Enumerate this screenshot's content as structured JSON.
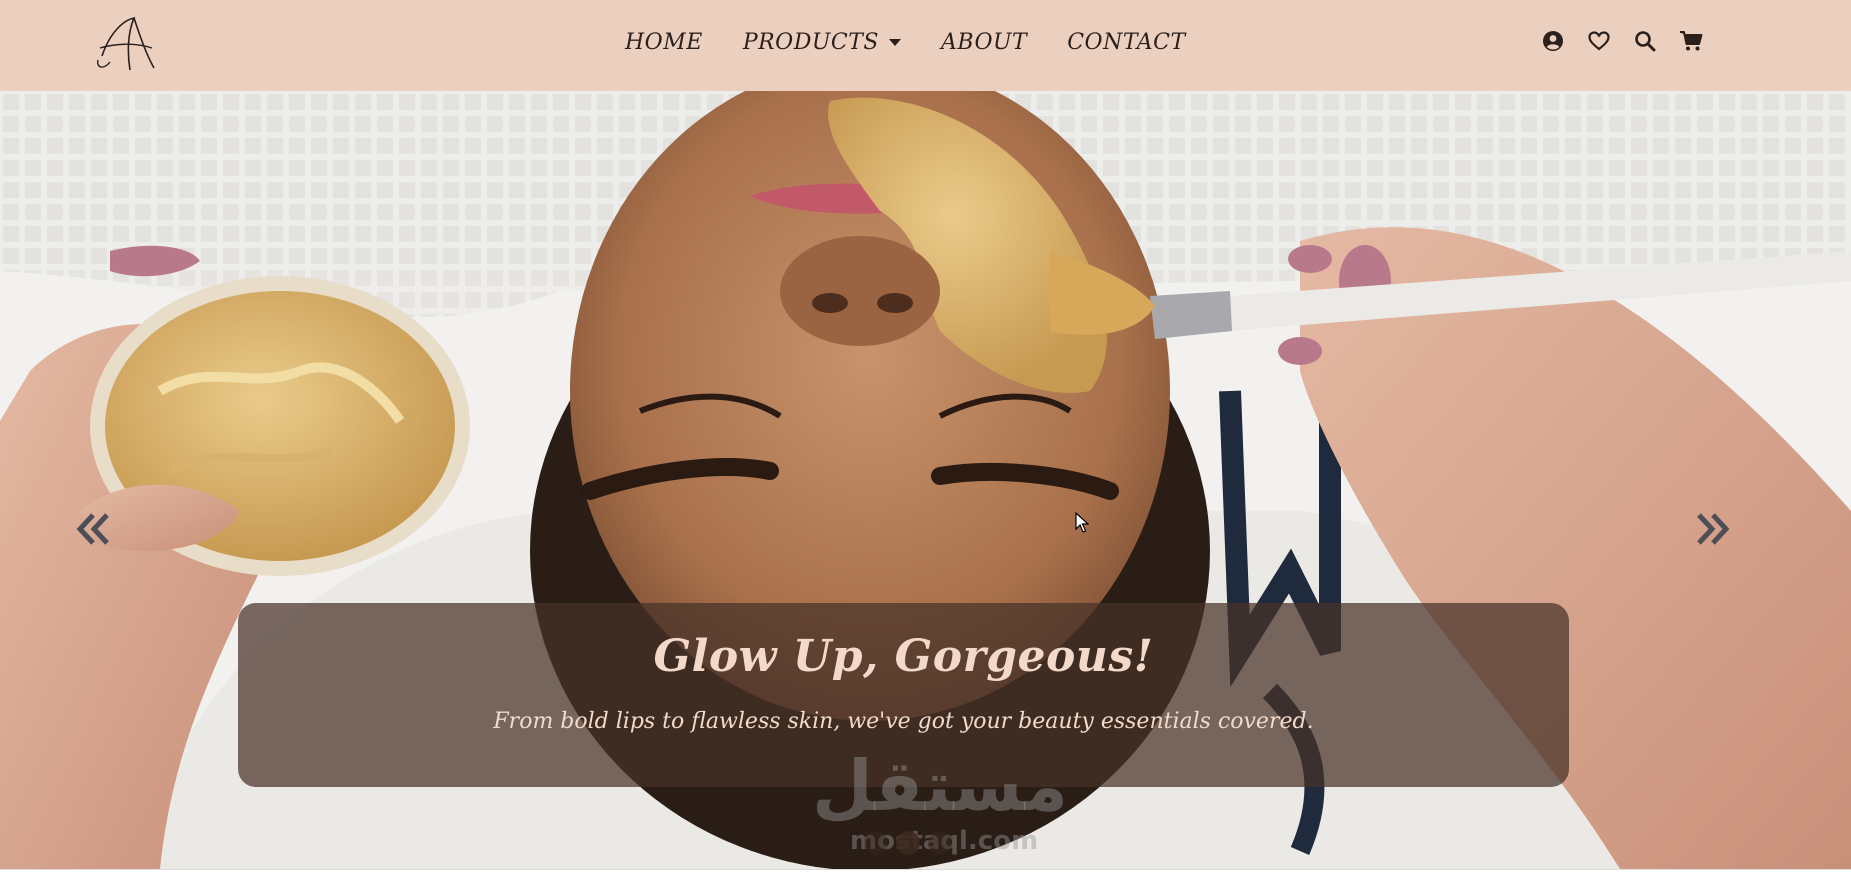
{
  "nav": {
    "home": "HOME",
    "products": "PRODUCTS",
    "about": "ABOUT",
    "contact": "CONTACT",
    "icons": [
      "user-circle-icon",
      "heart-icon",
      "search-icon",
      "cart-icon"
    ]
  },
  "hero": {
    "title": "Glow Up, Gorgeous!",
    "subtitle": "From bold lips to flawless skin, we've got your beauty essentials covered.",
    "prev_icon": "double-chevron-left-icon",
    "next_icon": "double-chevron-right-icon",
    "slides_count": 3,
    "active_slide": 2
  },
  "watermark": {
    "text": "مستقل",
    "sub": "mostaql.com"
  },
  "colors": {
    "navbar_bg": "#ebd0c0",
    "nav_text": "#2b1f1c",
    "caption_bg": "rgba(70, 50, 40, 0.72)",
    "caption_text": "#f2d9c9"
  }
}
